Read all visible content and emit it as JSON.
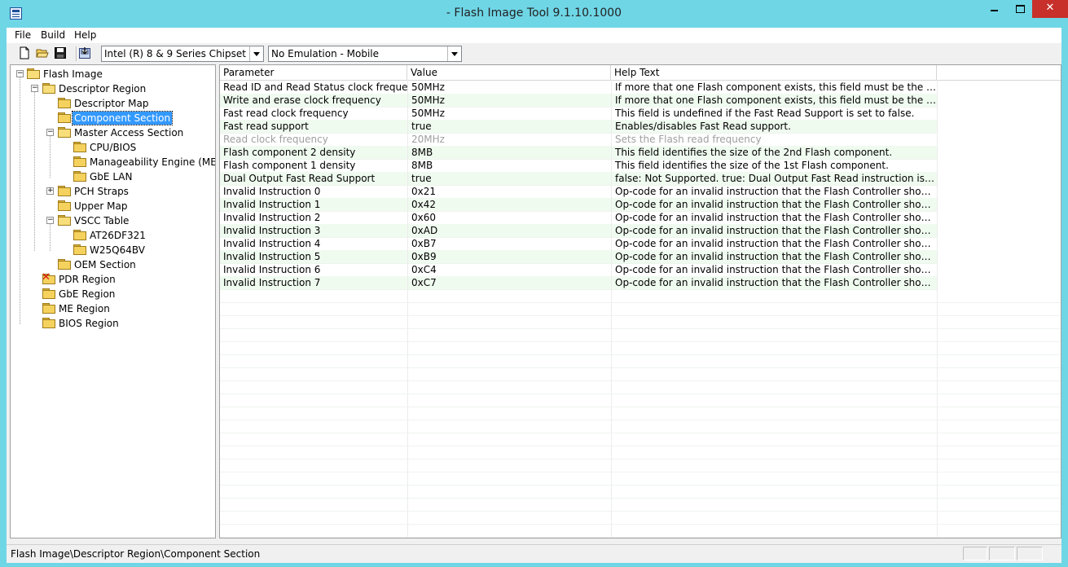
{
  "window": {
    "title": "- Flash Image Tool 9.1.10.1000"
  },
  "menubar": {
    "items": [
      "File",
      "Build",
      "Help"
    ]
  },
  "toolbar": {
    "chipset_combo": "Intel (R) 8 & 9 Series Chipset",
    "emulation_combo": "No Emulation - Mobile",
    "icons": [
      "new-file-icon",
      "open-folder-icon",
      "save-icon",
      "build-image-icon"
    ]
  },
  "tree": {
    "nodes": [
      {
        "label": "Flash Image",
        "icon": "folder-open-icon"
      },
      {
        "label": "Descriptor Region",
        "icon": "folder-open-icon"
      },
      {
        "label": "Descriptor Map",
        "icon": "folder-icon"
      },
      {
        "label": "Component Section",
        "icon": "folder-icon",
        "selected": true
      },
      {
        "label": "Master Access Section",
        "icon": "folder-open-icon"
      },
      {
        "label": "CPU/BIOS",
        "icon": "folder-icon"
      },
      {
        "label": "Manageability Engine (ME)",
        "icon": "folder-icon"
      },
      {
        "label": "GbE LAN",
        "icon": "folder-icon"
      },
      {
        "label": "PCH Straps",
        "icon": "folder-icon"
      },
      {
        "label": "Upper Map",
        "icon": "folder-icon"
      },
      {
        "label": "VSCC Table",
        "icon": "folder-open-icon"
      },
      {
        "label": "AT26DF321",
        "icon": "folder-icon"
      },
      {
        "label": "W25Q64BV",
        "icon": "folder-icon"
      },
      {
        "label": "OEM Section",
        "icon": "folder-icon"
      },
      {
        "label": "PDR Region",
        "icon": "disabled-folder-icon"
      },
      {
        "label": "GbE Region",
        "icon": "folder-icon"
      },
      {
        "label": "ME Region",
        "icon": "folder-icon"
      },
      {
        "label": "BIOS Region",
        "icon": "folder-icon"
      }
    ]
  },
  "grid": {
    "columns": [
      "Parameter",
      "Value",
      "Help Text"
    ],
    "rows": [
      {
        "param": "Read ID and Read Status clock frequency",
        "value": "50MHz",
        "help": "If more that one Flash component exists, this field must be the lowest c..."
      },
      {
        "param": "Write and erase clock frequency",
        "value": "50MHz",
        "help": "If more that one Flash component exists, this field must be the lowest c..."
      },
      {
        "param": "Fast read clock frequency",
        "value": "50MHz",
        "help": "This field is undefined if the Fast Read Support is set to false."
      },
      {
        "param": "Fast read support",
        "value": "true",
        "help": "Enables/disables Fast Read support."
      },
      {
        "param": "Read clock frequency",
        "value": "20MHz",
        "help": "Sets the Flash read frequency",
        "disabled": true
      },
      {
        "param": "Flash component 2 density",
        "value": "8MB",
        "help": "This field identifies the size of the 2nd Flash component."
      },
      {
        "param": "Flash component 1 density",
        "value": "8MB",
        "help": "This field identifies the size of the 1st Flash component."
      },
      {
        "param": "Dual Output Fast Read Support",
        "value": "true",
        "help": "false: Not Supported. true: Dual Output Fast Read instruction is issued in..."
      },
      {
        "param": "Invalid Instruction 0",
        "value": "0x21",
        "help": "Op-code for an invalid instruction that the Flash Controller should prote..."
      },
      {
        "param": "Invalid Instruction 1",
        "value": "0x42",
        "help": "Op-code for an invalid instruction that the Flash Controller should prote..."
      },
      {
        "param": "Invalid Instruction 2",
        "value": "0x60",
        "help": "Op-code for an invalid instruction that the Flash Controller should prote..."
      },
      {
        "param": "Invalid Instruction 3",
        "value": "0xAD",
        "help": "Op-code for an invalid instruction that the Flash Controller should prote..."
      },
      {
        "param": "Invalid Instruction 4",
        "value": "0xB7",
        "help": "Op-code for an invalid instruction that the Flash Controller should prote..."
      },
      {
        "param": "Invalid Instruction 5",
        "value": "0xB9",
        "help": "Op-code for an invalid instruction that the Flash Controller should prote..."
      },
      {
        "param": "Invalid Instruction 6",
        "value": "0xC4",
        "help": "Op-code for an invalid instruction that the Flash Controller should prote..."
      },
      {
        "param": "Invalid Instruction 7",
        "value": "0xC7",
        "help": "Op-code for an invalid instruction that the Flash Controller should prote..."
      }
    ]
  },
  "statusbar": {
    "path": "Flash Image\\Descriptor Region\\Component Section"
  },
  "colors": {
    "titlebar": "#6fd6e6",
    "close_button": "#c7302b",
    "selection": "#3399ff",
    "row_alt": "#f0fbf0"
  }
}
